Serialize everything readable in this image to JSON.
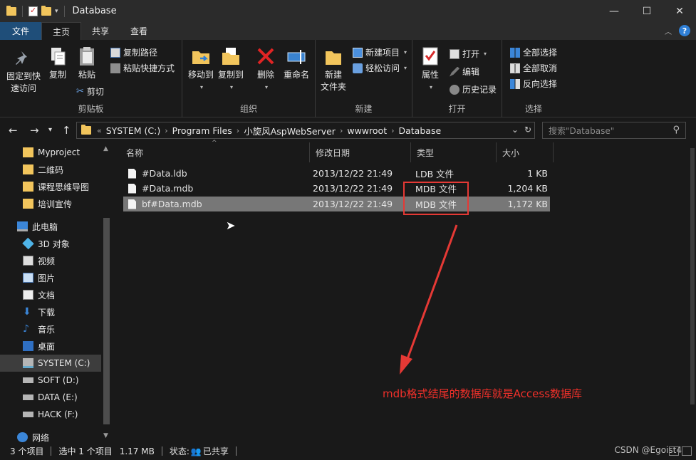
{
  "window": {
    "title": "Database",
    "controls": {
      "minimize": "—",
      "maximize": "☐",
      "close": "✕"
    }
  },
  "ribbon_tabs": [
    "文件",
    "主页",
    "共享",
    "查看"
  ],
  "ribbon": {
    "clipboard": {
      "label": "剪贴板",
      "pin": "固定到快\n速访问",
      "copy": "复制",
      "paste": "粘贴",
      "copy_path": "复制路径",
      "paste_shortcut": "粘贴快捷方式",
      "cut": "剪切"
    },
    "organize": {
      "label": "组织",
      "move_to": "移动到",
      "copy_to": "复制到",
      "delete": "删除",
      "rename": "重命名"
    },
    "new": {
      "label": "新建",
      "new_folder": "新建\n文件夹",
      "new_item": "新建项目",
      "easy_access": "轻松访问"
    },
    "open": {
      "label": "打开",
      "properties": "属性",
      "open": "打开",
      "edit": "编辑",
      "history": "历史记录"
    },
    "select": {
      "label": "选择",
      "select_all": "全部选择",
      "select_none": "全部取消",
      "invert": "反向选择"
    }
  },
  "address": {
    "prefix": "«",
    "crumbs": [
      "SYSTEM (C:)",
      "Program Files",
      "小旋风AspWebServer",
      "wwwroot",
      "Database"
    ],
    "search_placeholder": "搜索\"Database\""
  },
  "sidebar": {
    "items": [
      {
        "label": "Myproject",
        "icon": "folder-icon"
      },
      {
        "label": "二维码",
        "icon": "folder-icon"
      },
      {
        "label": "课程思维导图",
        "icon": "folder-icon"
      },
      {
        "label": "培训宣传",
        "icon": "folder-icon"
      },
      {
        "label": "此电脑",
        "icon": "computer-icon"
      },
      {
        "label": "3D 对象",
        "icon": "3d-objects-icon"
      },
      {
        "label": "视频",
        "icon": "video-icon"
      },
      {
        "label": "图片",
        "icon": "pictures-icon"
      },
      {
        "label": "文档",
        "icon": "documents-icon"
      },
      {
        "label": "下载",
        "icon": "downloads-icon"
      },
      {
        "label": "音乐",
        "icon": "music-icon"
      },
      {
        "label": "桌面",
        "icon": "desktop-icon"
      },
      {
        "label": "SYSTEM (C:)",
        "icon": "system-drive-icon"
      },
      {
        "label": "SOFT (D:)",
        "icon": "drive-icon"
      },
      {
        "label": "DATA (E:)",
        "icon": "drive-icon"
      },
      {
        "label": "HACK (F:)",
        "icon": "drive-icon"
      },
      {
        "label": "网络",
        "icon": "network-icon"
      }
    ],
    "selected_label": "SYSTEM (C:)"
  },
  "columns": {
    "name": "名称",
    "date": "修改日期",
    "type": "类型",
    "size": "大小"
  },
  "files": [
    {
      "name": "#Data.ldb",
      "date": "2013/12/22 21:49",
      "type": "LDB 文件",
      "size": "1 KB"
    },
    {
      "name": "#Data.mdb",
      "date": "2013/12/22 21:49",
      "type": "MDB 文件",
      "size": "1,204 KB"
    },
    {
      "name": "bf#Data.mdb",
      "date": "2013/12/22 21:49",
      "type": "MDB 文件",
      "size": "1,172 KB"
    }
  ],
  "selected_file": "bf#Data.mdb",
  "annotation": {
    "text": "mdb格式结尾的数据库就是Access数据库",
    "color": "#f0302a"
  },
  "status": {
    "item_count": "3 个项目",
    "selection": "选中 1 个项目",
    "selection_size": "1.17 MB",
    "state": "状态:",
    "shared": "已共享"
  },
  "watermark": "CSDN @Egoist4",
  "colors": {
    "accent_tab": "#1f4e79",
    "folder": "#f2c55c",
    "highlight_box": "#e53935"
  }
}
